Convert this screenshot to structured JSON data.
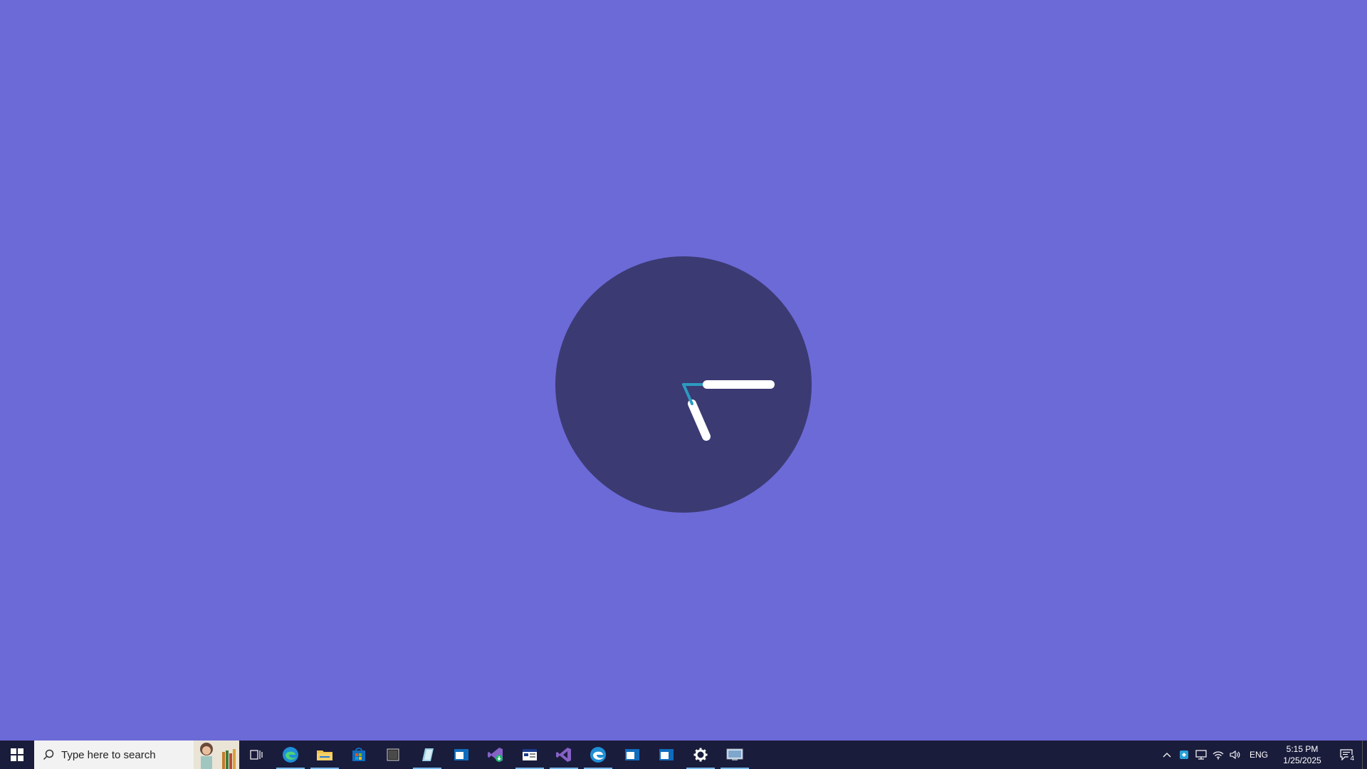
{
  "desktop": {
    "background_color": "#6c6ad7",
    "clock": {
      "face_color": "#3b3a73",
      "hour_hand_color": "#ffffff",
      "minute_hand_color": "#ffffff",
      "second_hand_color": "#2c9ac0",
      "time": "5:15"
    }
  },
  "taskbar": {
    "background_color": "#1a1c3c",
    "search": {
      "placeholder": "Type here to search"
    },
    "apps": [
      {
        "name": "edge-icon",
        "running": true
      },
      {
        "name": "file-explorer-icon",
        "running": true
      },
      {
        "name": "store-icon",
        "running": false
      },
      {
        "name": "terminal-icon",
        "running": false
      },
      {
        "name": "editor-icon",
        "running": true
      },
      {
        "name": "window-app-icon",
        "running": false
      },
      {
        "name": "visual-studio-installer-icon",
        "running": false
      },
      {
        "name": "calendar-app-icon",
        "running": true
      },
      {
        "name": "visual-studio-icon",
        "running": true
      },
      {
        "name": "edge-dev-icon",
        "running": true
      },
      {
        "name": "window-app-2-icon",
        "running": false
      },
      {
        "name": "window-app-3-icon",
        "running": false
      },
      {
        "name": "settings-gear-icon",
        "running": true
      },
      {
        "name": "remote-desktop-icon",
        "running": true
      }
    ],
    "tray": {
      "language": "ENG",
      "time": "5:15 PM",
      "date": "1/25/2025",
      "notification_count": "4"
    }
  }
}
